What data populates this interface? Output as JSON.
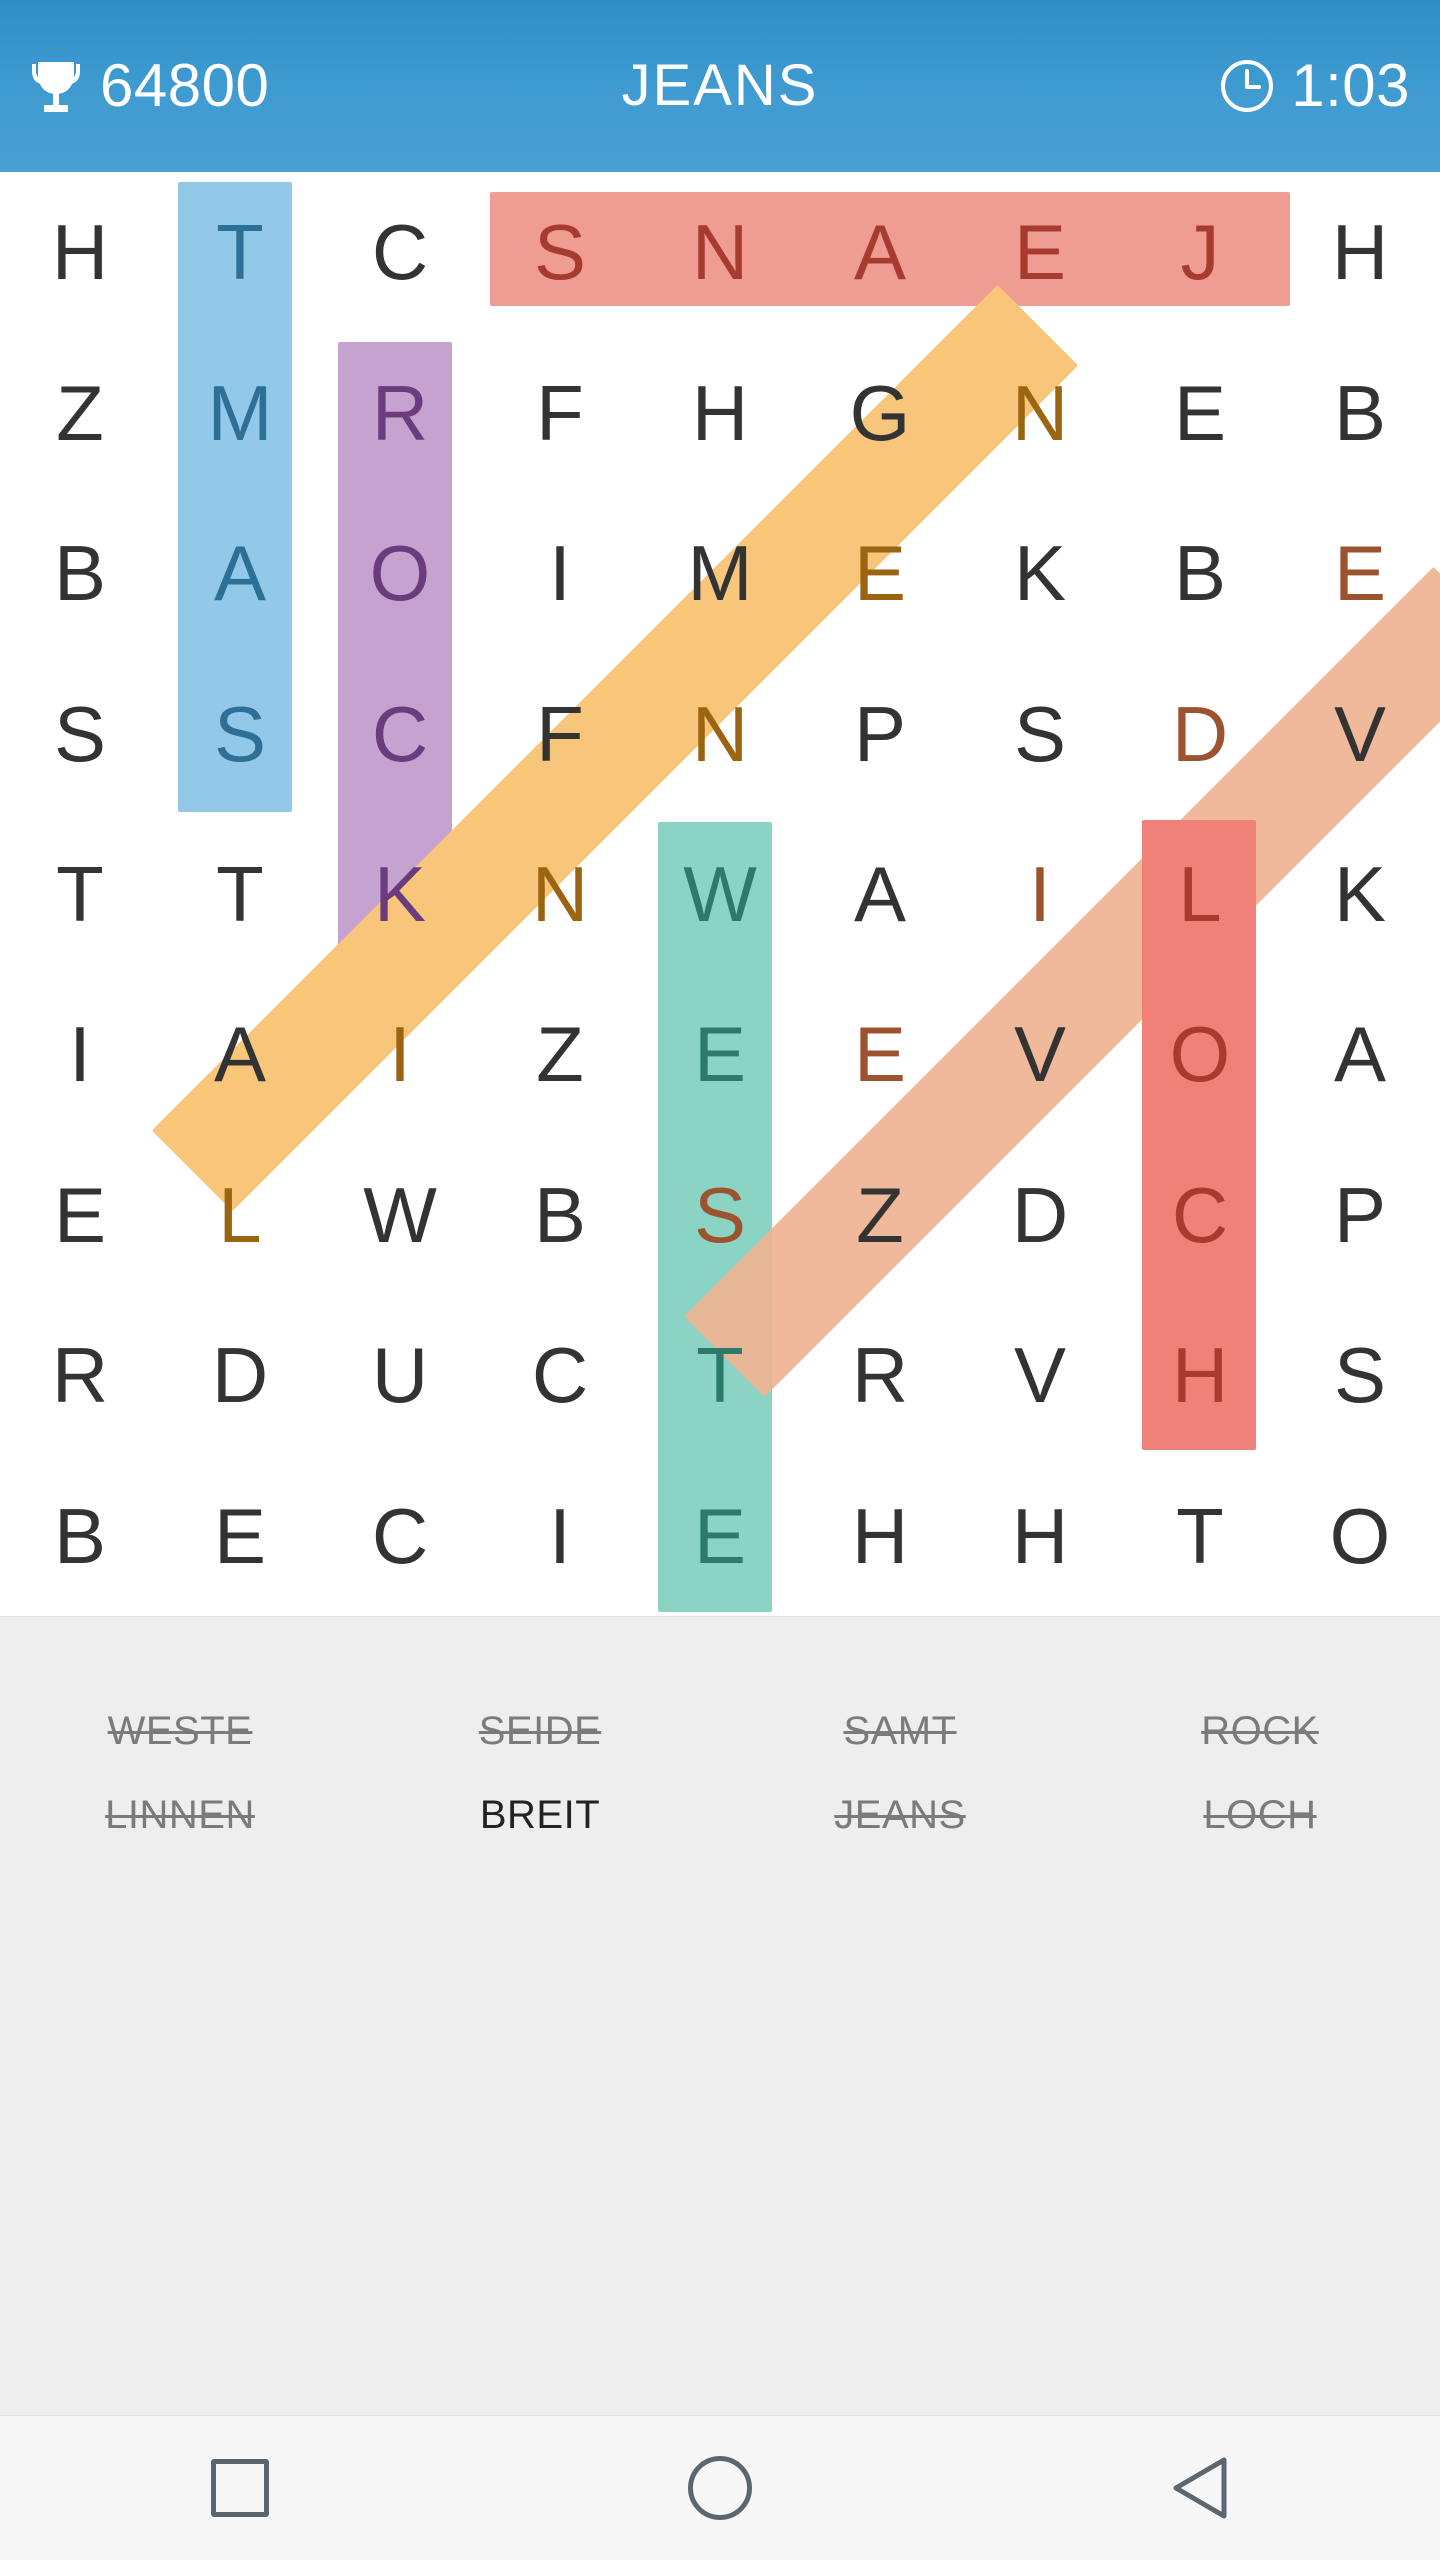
{
  "header": {
    "trophy_icon": "trophy-icon",
    "score": "64800",
    "title": "JEANS",
    "clock_icon": "clock-icon",
    "timer": "1:03",
    "bar_color": "#3d9ad0"
  },
  "grid": {
    "rows": 9,
    "cols": 9,
    "letters": [
      [
        "H",
        "T",
        "C",
        "S",
        "N",
        "A",
        "E",
        "J",
        "H"
      ],
      [
        "Z",
        "M",
        "R",
        "F",
        "H",
        "G",
        "N",
        "E",
        "B"
      ],
      [
        "B",
        "A",
        "O",
        "I",
        "M",
        "E",
        "K",
        "B",
        "E"
      ],
      [
        "S",
        "S",
        "C",
        "F",
        "N",
        "P",
        "S",
        "D",
        "V"
      ],
      [
        "T",
        "T",
        "K",
        "N",
        "W",
        "A",
        "I",
        "L",
        "K"
      ],
      [
        "I",
        "A",
        "I",
        "Z",
        "E",
        "E",
        "V",
        "O",
        "A"
      ],
      [
        "E",
        "L",
        "W",
        "B",
        "S",
        "Z",
        "D",
        "C",
        "P"
      ],
      [
        "R",
        "D",
        "U",
        "C",
        "T",
        "R",
        "V",
        "H",
        "S"
      ],
      [
        "B",
        "E",
        "C",
        "I",
        "E",
        "H",
        "H",
        "T",
        "O"
      ]
    ],
    "highlights": [
      {
        "word": "SAMT",
        "shape": "vertical",
        "color": "#92c9e8",
        "text_color": "#2e6f96",
        "col": 1,
        "row_start": 0,
        "row_end": 3
      },
      {
        "word": "ROCK",
        "shape": "vertical",
        "color": "#c5a2d0",
        "text_color": "#6a3c7d",
        "col": 2,
        "row_start": 1,
        "row_end": 4
      },
      {
        "word": "JEANS",
        "shape": "horizontal",
        "color": "#ef9c93",
        "text_color": "#a73b30",
        "row": 0,
        "col_start": 3,
        "col_end": 7
      },
      {
        "word": "LINNEN",
        "shape": "diagonal",
        "color": "#f7c67a",
        "text_color": "#9a6411",
        "from": [
          0,
          6
        ],
        "to": [
          6,
          1
        ]
      },
      {
        "word": "WESTE",
        "shape": "vertical",
        "color": "#8bd4c4",
        "text_color": "#2d7a6b",
        "col": 4,
        "row_start": 4,
        "row_end": 8
      },
      {
        "word": "SEIDE",
        "shape": "diagonal",
        "color": "#efb392",
        "text_color": "#9c5430",
        "from": [
          2,
          8
        ],
        "to": [
          7,
          3
        ]
      },
      {
        "word": "LOCH",
        "shape": "vertical",
        "color": "#ef8179",
        "text_color": "#a73b30",
        "col": 7,
        "row_start": 4,
        "row_end": 7
      }
    ]
  },
  "wordlist": {
    "words": [
      {
        "text": "WESTE",
        "found": true
      },
      {
        "text": "SEIDE",
        "found": true
      },
      {
        "text": "SAMT",
        "found": true
      },
      {
        "text": "ROCK",
        "found": true
      },
      {
        "text": "LINNEN",
        "found": true
      },
      {
        "text": "BREIT",
        "found": false
      },
      {
        "text": "JEANS",
        "found": true
      },
      {
        "text": "LOCH",
        "found": true
      }
    ]
  },
  "navbar": {
    "recents_label": "recents-square-icon",
    "home_label": "home-circle-icon",
    "back_label": "back-triangle-icon"
  }
}
